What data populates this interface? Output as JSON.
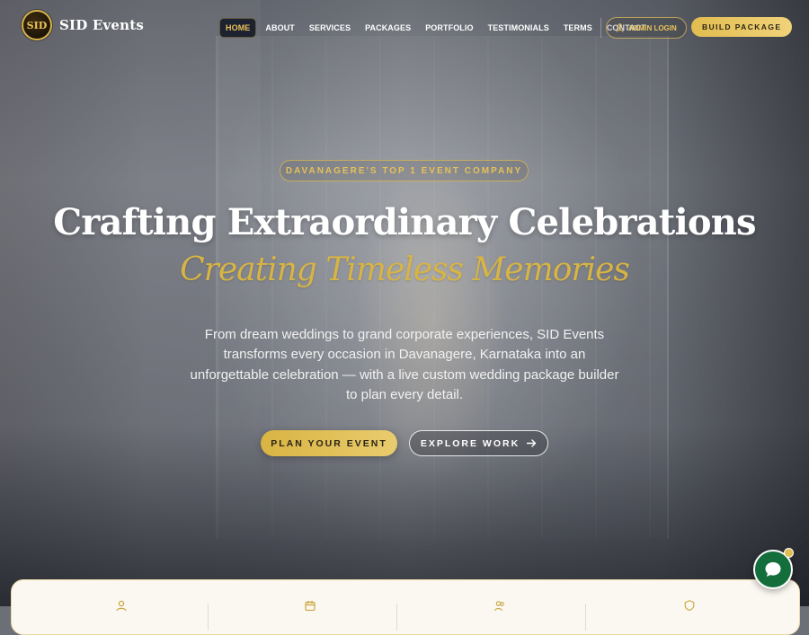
{
  "brand": {
    "name": "SID Events",
    "logo_text": "SID"
  },
  "nav": {
    "items": [
      {
        "label": "HOME",
        "active": true
      },
      {
        "label": "ABOUT"
      },
      {
        "label": "SERVICES"
      },
      {
        "label": "PACKAGES"
      },
      {
        "label": "PORTFOLIO"
      },
      {
        "label": "TESTIMONIALS"
      },
      {
        "label": "TERMS"
      },
      {
        "label": "CONTACT"
      }
    ],
    "admin_label": "ADMIN LOGIN",
    "build_label": "BUILD PACKAGE"
  },
  "hero": {
    "badge": "DAVANAGERE'S TOP 1 EVENT COMPANY",
    "title": "Crafting Extraordinary Celebrations",
    "script": "Creating Timeless Memories",
    "description": "From dream weddings to grand corporate experiences, SID Events transforms every occasion in Davanagere, Karnataka into an unforgettable celebration — with a live custom wedding package builder to plan every detail.",
    "cta_primary": "PLAN YOUR EVENT",
    "cta_secondary": "EXPLORE WORK"
  },
  "stats_icons": [
    "user-icon",
    "calendar-icon",
    "users-icon",
    "shield-icon"
  ],
  "chat": {
    "icon": "chat-bubble-icon"
  },
  "colors": {
    "gold": "#e2bd4f",
    "dark": "#1d2230",
    "chat_green": "#136e3c",
    "card": "#fbf8f1"
  }
}
